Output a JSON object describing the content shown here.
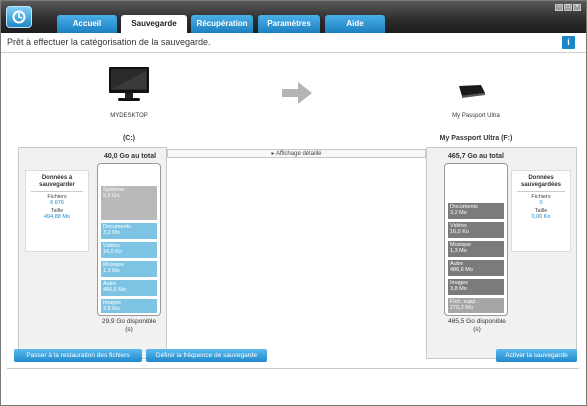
{
  "tabs": [
    {
      "label": "Accueil"
    },
    {
      "label": "Sauvegarde"
    },
    {
      "label": "Récupération"
    },
    {
      "label": "Paramètres"
    },
    {
      "label": "Aide"
    }
  ],
  "header": {
    "message": "Prêt à effectuer la catégorisation de la sauvegarde.",
    "info_label": "i"
  },
  "source": {
    "device_name": "MYDESKTOP",
    "drive": "(C:)",
    "total": "40,0 Go au total",
    "available_line1": "29,9 Go disponible",
    "available_line2": "(s)",
    "panel": {
      "heading_line1": "Données à",
      "heading_line2": "sauvegarder",
      "files_label": "Fichiers",
      "files_value": "6 676",
      "size_label": "Taille",
      "size_value": "494,88 Mo"
    },
    "segments": [
      {
        "name": "Système",
        "size": "9,6 Go"
      },
      {
        "name": "Documents",
        "size": "3,2 Mo"
      },
      {
        "name": "Vidéos",
        "size": "16,0 Ko"
      },
      {
        "name": "Musique",
        "size": "1,3 Mo"
      },
      {
        "name": "Autre",
        "size": "486,6 Mo"
      },
      {
        "name": "Images",
        "size": "3,8 Mo"
      }
    ]
  },
  "destination": {
    "device_name": "My Passport Ultra",
    "drive": "My Passport Ultra (F:)",
    "total": "465,7 Go au total",
    "available_line1": "465,5 Go disponible",
    "available_line2": "(s)",
    "panel": {
      "heading_line1": "Données",
      "heading_line2": "sauvegardées",
      "files_label": "Fichiers",
      "files_value": "0",
      "size_label": "Taille",
      "size_value": "0,00 Ko"
    },
    "segments": [
      {
        "name": "Documents",
        "size": "3,2 Mo"
      },
      {
        "name": "Vidéos",
        "size": "16,0 Ko"
      },
      {
        "name": "Musique",
        "size": "1,3 Mo"
      },
      {
        "name": "Autre",
        "size": "486,6 Mo"
      },
      {
        "name": "Images",
        "size": "3,8 Mo"
      },
      {
        "name": "Fich. supp.",
        "size": "270,2 Mo"
      }
    ]
  },
  "detail_toggle": "Affichage détaillé",
  "buttons": {
    "restore": "Passer à la restauration des fichiers",
    "frequency": "Définir la fréquence de sauvegarde",
    "activate": "Activer la sauvegarde"
  },
  "colors": {
    "accent": "#1b87c9",
    "source_segment": "#7dc4e4",
    "dest_segment": "#7b7b7b",
    "system_segment": "#b9b9b9"
  }
}
